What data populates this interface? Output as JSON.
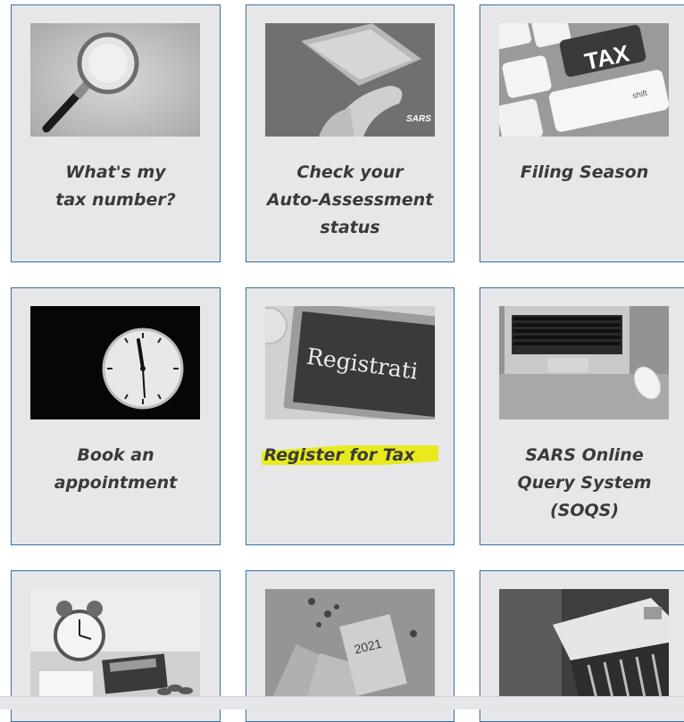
{
  "cards": [
    {
      "label": "What's my\ntax number?",
      "image": "magnifying-glass-icon"
    },
    {
      "label": "Check your\nAuto-Assessment\nstatus",
      "image": "phone-sars-image",
      "image_text": "SARS"
    },
    {
      "label": "Filing Season",
      "image": "tax-keyboard-image",
      "image_text": "TAX",
      "image_text_2": "shift"
    },
    {
      "label": "Book an\nappointment",
      "image": "clock-icon"
    },
    {
      "label": "Register for Tax",
      "image": "registration-chalkboard-image",
      "image_text": "Registrati",
      "highlight": "#e8ea1e"
    },
    {
      "label": "SARS Online\nQuery System\n(SOQS)",
      "image": "laptop-mouse-image"
    },
    {
      "label": "",
      "image": "alarm-clock-calculator-image"
    },
    {
      "label": "",
      "image": "notebook-2021-image",
      "image_text": "2021"
    },
    {
      "label": "",
      "image": "file-box-image"
    }
  ],
  "colors": {
    "card_bg": "#e7e7ea",
    "card_border": "#3a6f98",
    "label_text": "#3a3a3c",
    "highlight": "#e8ea1e"
  }
}
